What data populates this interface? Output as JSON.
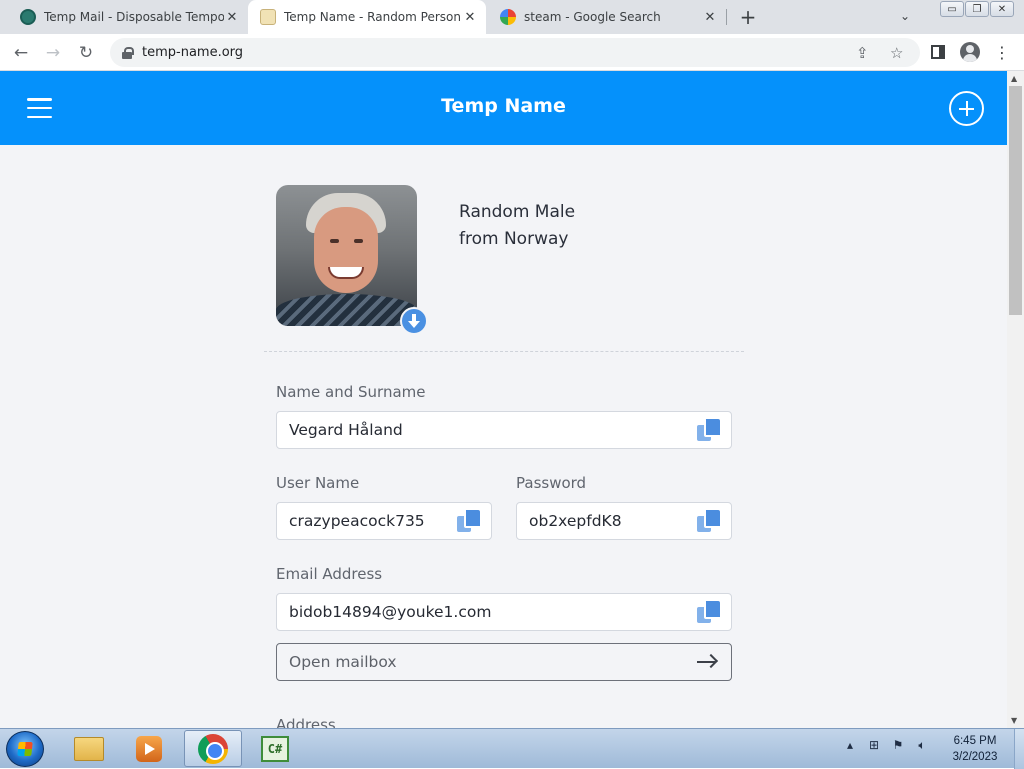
{
  "browser": {
    "tabs": [
      {
        "title": "Temp Mail - Disposable Tempora",
        "favicon": "temp-mail-favicon",
        "active": false
      },
      {
        "title": "Temp Name - Random Person Ge",
        "favicon": "temp-name-favicon",
        "active": true
      },
      {
        "title": "steam - Google Search",
        "favicon": "google-favicon",
        "active": false
      }
    ],
    "url": "temp-name.org"
  },
  "app": {
    "brand": "Temp Name",
    "accent_color": "#0591fb"
  },
  "person": {
    "desc_line1": "Random Male",
    "desc_line2": "from Norway"
  },
  "form": {
    "name_label": "Name and Surname",
    "name_value": "Vegard Håland",
    "username_label": "User Name",
    "username_value": "crazypeacock735",
    "password_label": "Password",
    "password_value": "ob2xepfdK8",
    "email_label": "Email Address",
    "email_value": "bidob14894@youke1.com",
    "mailbox_label": "Open mailbox",
    "address_label": "Address"
  },
  "taskbar": {
    "time": "6:45 PM",
    "date": "3/2/2023",
    "csharp_label": "C#"
  }
}
